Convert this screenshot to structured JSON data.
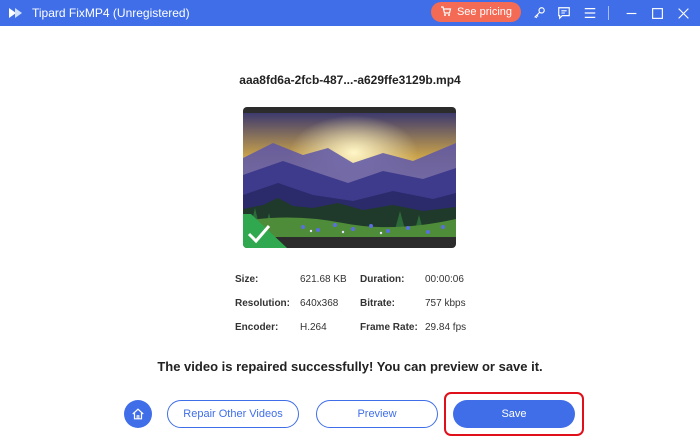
{
  "window": {
    "title": "Tipard FixMP4 (Unregistered)",
    "pricing_label": "See pricing",
    "icons": [
      "logo-icon",
      "cart-icon",
      "key-icon",
      "feedback-icon",
      "menu-icon",
      "minimize-icon",
      "maximize-icon",
      "close-icon"
    ]
  },
  "file": {
    "name": "aaa8fd6a-2fcb-487...-a629ffe3129b.mp4"
  },
  "info": {
    "size_label": "Size:",
    "size_value": "621.68 KB",
    "duration_label": "Duration:",
    "duration_value": "00:00:06",
    "resolution_label": "Resolution:",
    "resolution_value": "640x368",
    "bitrate_label": "Bitrate:",
    "bitrate_value": "757 kbps",
    "encoder_label": "Encoder:",
    "encoder_value": "H.264",
    "framerate_label": "Frame Rate:",
    "framerate_value": "29.84 fps"
  },
  "message": "The video is repaired successfully! You can preview or save it.",
  "actions": {
    "repair_other_label": "Repair Other Videos",
    "preview_label": "Preview",
    "save_label": "Save"
  },
  "colors": {
    "primary": "#3f6ee8",
    "pricing": "#f36a55",
    "highlight": "#e0101a",
    "success": "#2fa84f"
  }
}
